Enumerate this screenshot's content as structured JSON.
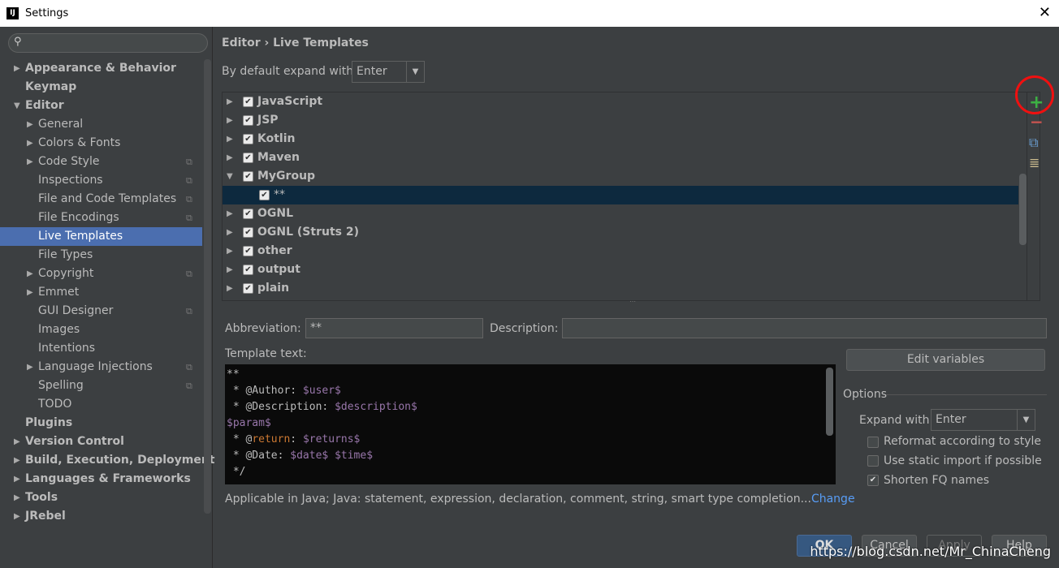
{
  "window": {
    "title": "Settings",
    "logo": "IJ",
    "close": "✕"
  },
  "sidebar": {
    "items": [
      {
        "label": "Appearance & Behavior",
        "bold": true,
        "arrow": "right",
        "level": 0
      },
      {
        "label": "Keymap",
        "bold": true,
        "level": 0
      },
      {
        "label": "Editor",
        "bold": true,
        "arrow": "down",
        "level": 0
      },
      {
        "label": "General",
        "arrow": "right",
        "level": 1
      },
      {
        "label": "Colors & Fonts",
        "arrow": "right",
        "level": 1
      },
      {
        "label": "Code Style",
        "arrow": "right",
        "level": 1,
        "copy": true
      },
      {
        "label": "Inspections",
        "level": 1,
        "copy": true
      },
      {
        "label": "File and Code Templates",
        "level": 1,
        "copy": true
      },
      {
        "label": "File Encodings",
        "level": 1,
        "copy": true
      },
      {
        "label": "Live Templates",
        "level": 1,
        "selected": true
      },
      {
        "label": "File Types",
        "level": 1
      },
      {
        "label": "Copyright",
        "arrow": "right",
        "level": 1,
        "copy": true
      },
      {
        "label": "Emmet",
        "arrow": "right",
        "level": 1
      },
      {
        "label": "GUI Designer",
        "level": 1,
        "copy": true
      },
      {
        "label": "Images",
        "level": 1
      },
      {
        "label": "Intentions",
        "level": 1
      },
      {
        "label": "Language Injections",
        "arrow": "right",
        "level": 1,
        "copy": true
      },
      {
        "label": "Spelling",
        "level": 1,
        "copy": true
      },
      {
        "label": "TODO",
        "level": 1
      },
      {
        "label": "Plugins",
        "bold": true,
        "level": 0
      },
      {
        "label": "Version Control",
        "bold": true,
        "arrow": "right",
        "level": 0
      },
      {
        "label": "Build, Execution, Deployment",
        "bold": true,
        "arrow": "right",
        "level": 0
      },
      {
        "label": "Languages & Frameworks",
        "bold": true,
        "arrow": "right",
        "level": 0
      },
      {
        "label": "Tools",
        "bold": true,
        "arrow": "right",
        "level": 0
      },
      {
        "label": "JRebel",
        "bold": true,
        "arrow": "right",
        "level": 0
      }
    ]
  },
  "breadcrumb": "Editor › Live Templates",
  "expand": {
    "label": "By default expand with",
    "value": "Enter"
  },
  "templates": [
    {
      "label": "JavaScript",
      "arrow": "right"
    },
    {
      "label": "JSP",
      "arrow": "right"
    },
    {
      "label": "Kotlin",
      "arrow": "right"
    },
    {
      "label": "Maven",
      "arrow": "right"
    },
    {
      "label": "MyGroup",
      "arrow": "down"
    },
    {
      "label": "**",
      "child": true,
      "selected": true
    },
    {
      "label": "OGNL",
      "arrow": "right"
    },
    {
      "label": "OGNL (Struts 2)",
      "arrow": "right"
    },
    {
      "label": "other",
      "arrow": "right"
    },
    {
      "label": "output",
      "arrow": "right"
    },
    {
      "label": "plain",
      "arrow": "right"
    }
  ],
  "tools": {
    "add": "+",
    "remove": "−",
    "copy": "⧉",
    "text": "≣"
  },
  "abbreviation": {
    "label": "Abbreviation:",
    "value": "**"
  },
  "description": {
    "label": "Description:",
    "value": ""
  },
  "template_text": {
    "label": "Template text:"
  },
  "edit_variables": "Edit variables",
  "options": {
    "title": "Options",
    "expand_label": "Expand with",
    "expand_value": "Enter",
    "reformat": {
      "label": "Reformat according to style",
      "checked": false
    },
    "static_import": {
      "label": "Use static import if possible",
      "checked": false
    },
    "shorten": {
      "label": "Shorten FQ names",
      "checked": true
    }
  },
  "applicable": {
    "text": "Applicable in Java; Java: statement, expression, declaration, comment, string, smart type completion...",
    "link": "Change"
  },
  "buttons": {
    "ok": "OK",
    "cancel": "Cancel",
    "apply": "Apply",
    "help": "Help"
  },
  "watermark": "https://blog.csdn.net/Mr_ChinaCheng",
  "colors": {
    "selection": "#4b6eaf",
    "highlight": "#f01010",
    "link": "#589df6"
  }
}
